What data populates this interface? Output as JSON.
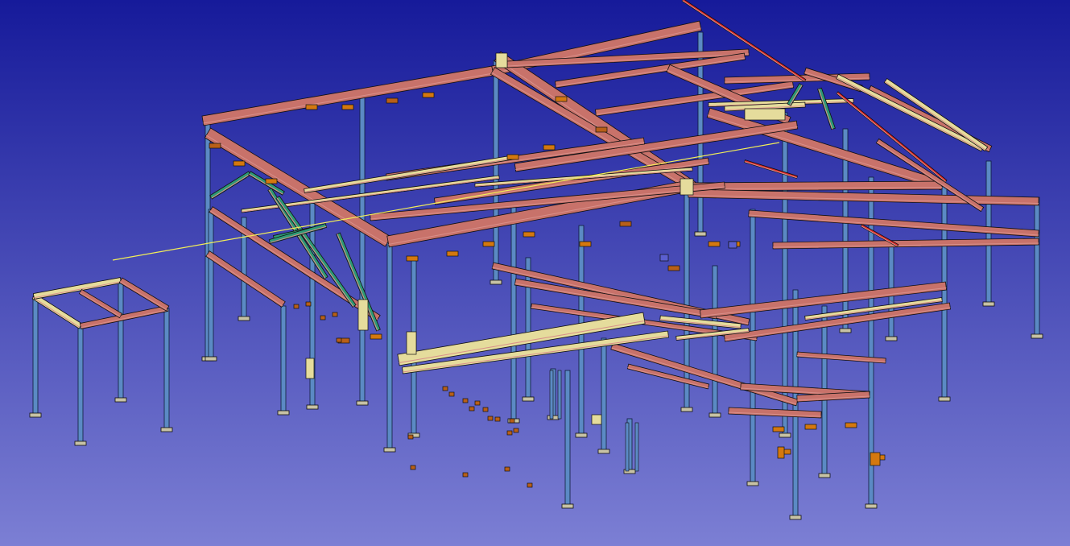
{
  "viewer": {
    "background_top": "#161a9a",
    "background_bottom": "#7c7fd4"
  },
  "palette": {
    "beam": "#c8726a",
    "beam_top": "#d9908a",
    "column": "#5b8ac4",
    "purlin": "#e5dc9c",
    "plate": "#d4780f",
    "brace": "#2e9a76",
    "red_member": "#e02828",
    "edge": "#101010",
    "guide_line": "#f2ee58"
  }
}
